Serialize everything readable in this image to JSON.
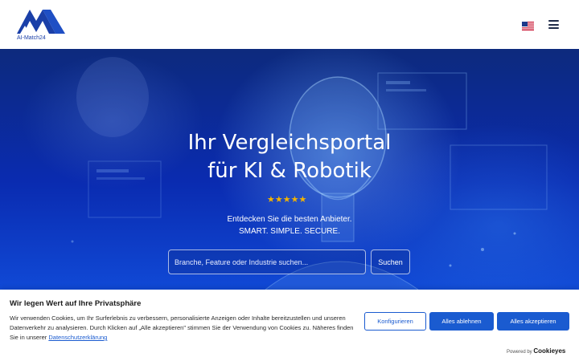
{
  "header": {
    "logo_text": "AI-Match24",
    "language_icon": "us-flag-icon",
    "menu_icon": "hamburger-menu-icon"
  },
  "hero": {
    "title_line1": "Ihr Vergleichsportal",
    "title_line2": "für KI & Robotik",
    "stars": "★★★★★",
    "rating_stars": 5,
    "subtitle_line1": "Entdecken Sie die besten Anbieter.",
    "subtitle_line2": "SMART. SIMPLE. SECURE.",
    "search_placeholder": "Branche, Feature oder Industrie suchen...",
    "search_value": "",
    "search_button": "Suchen"
  },
  "cookie_banner": {
    "title": "Wir legen Wert auf Ihre Privatsphäre",
    "text": "Wir verwenden Cookies, um Ihr Surferlebnis zu verbessern, personalisierte Anzeigen oder Inhalte bereitzustellen und unseren Datenverkehr zu analysieren. Durch Klicken auf „Alle akzeptieren\" stimmen Sie der Verwendung von Cookies zu. Näheres finden Sie in unserer",
    "link_text": "Datenschutzerklärung",
    "configure_button": "Konfigurieren",
    "reject_button": "Alles ablehnen",
    "accept_button": "Alles akzeptieren",
    "powered_by": "Powered by",
    "powered_brand": "Cookieyes"
  },
  "colors": {
    "brand_blue": "#1a5bd0",
    "logo_blue": "#1a3fa8",
    "star_gold": "#f4b400"
  }
}
